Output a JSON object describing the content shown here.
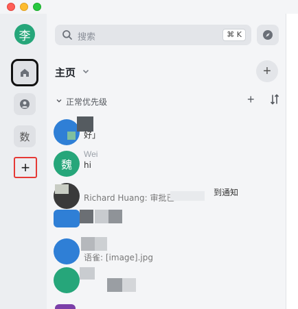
{
  "window": {
    "controls": [
      "close",
      "minimize",
      "zoom"
    ]
  },
  "rail": {
    "user_avatar": "李",
    "items": [
      {
        "icon": "home-icon",
        "active": true
      },
      {
        "icon": "contacts-icon"
      },
      {
        "label": "数"
      }
    ],
    "add_label": "+"
  },
  "search": {
    "placeholder": "搜索",
    "shortcut": "⌘ K",
    "icon": "search-icon"
  },
  "header": {
    "title": "主页",
    "add_label": "+"
  },
  "section": {
    "title": "正常优先级",
    "add_label": "+"
  },
  "chats": [
    {
      "avatar_text": "",
      "name": "",
      "preview": "好」",
      "meta": ""
    },
    {
      "avatar_text": "魏",
      "name": "Wei",
      "preview": "hi",
      "meta": ""
    },
    {
      "avatar_text": "",
      "name": "",
      "preview": "Richard Huang: 审批已",
      "meta": "到通知"
    },
    {
      "avatar_text": "",
      "name": "",
      "preview": "",
      "meta": ""
    },
    {
      "avatar_text": "",
      "name": "",
      "preview": "语雀: [image].jpg",
      "meta": ""
    },
    {
      "avatar_text": "",
      "name": "",
      "preview": "",
      "meta": ""
    },
    {
      "avatar_text": "",
      "name": "",
      "preview": "",
      "meta": ""
    }
  ],
  "colors": {
    "accent_green": "#26a67a",
    "blue_avatar": "#2f7fd6",
    "purple_avatar": "#7b3fa8",
    "highlight_red": "#e53935"
  }
}
